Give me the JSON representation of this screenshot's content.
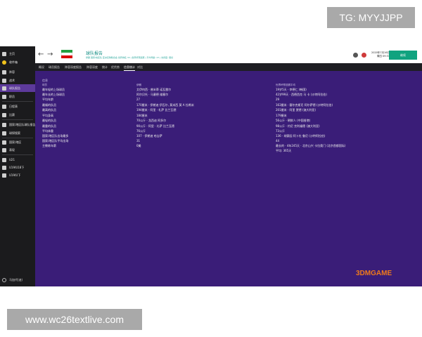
{
  "watermarks": {
    "tg": "TG: MYYJJPP",
    "url": "www.wc26textlive.com",
    "logo": "3DMGAME"
  },
  "sidebar": {
    "items": [
      {
        "label": "主页",
        "icon": "home-icon"
      },
      {
        "label": "收件箱",
        "icon": "coin-icon"
      },
      {
        "label": "阵容",
        "icon": "squad-icon"
      },
      {
        "label": "战术",
        "icon": "tactics-icon"
      },
      {
        "label": "球队报告",
        "icon": "report-icon"
      },
      {
        "label": "职员",
        "icon": "staff-icon"
      },
      {
        "label": "日程表",
        "icon": "calendar-icon"
      },
      {
        "label": "比赛",
        "icon": "trophy-icon"
      },
      {
        "label": "国家/地区队球队报告",
        "icon": "national-icon"
      },
      {
        "label": "球探搜索",
        "icon": "search-icon"
      },
      {
        "label": "国家/地区",
        "icon": "globe-icon"
      },
      {
        "label": "表现",
        "icon": "chart-icon"
      },
      {
        "label": "U21",
        "icon": "team-icon"
      },
      {
        "label": "U19/U18下",
        "icon": "team-icon"
      },
      {
        "label": "U19/U下",
        "icon": "team-icon"
      }
    ],
    "user": "马加代(迪)"
  },
  "header": {
    "title": "球队报告",
    "subtitle": "伊朗 国家/地区队 亚洲足球联合会 世界排名 33 | 世界杯预选赛 | 平均年龄: 27 | 支持度: 很好",
    "date": "2020年7月16日",
    "weekday": "周四 09:31",
    "continue": "继续"
  },
  "tabs": [
    {
      "label": "概况",
      "active": false
    },
    {
      "label": "球员报告",
      "active": false
    },
    {
      "label": "阵容深度报告",
      "active": false
    },
    {
      "label": "阵容深度",
      "active": false
    },
    {
      "label": "统计",
      "active": false
    },
    {
      "label": "优劣势",
      "active": false
    },
    {
      "label": "信息统计",
      "active": true
    },
    {
      "label": "对比",
      "active": false
    }
  ],
  "content": {
    "section_label": "信息",
    "col_headers": [
      "球员",
      "伊朗",
      "世界杯预选赛平均"
    ],
    "rows": [
      {
        "label": "最年轻的上场球员",
        "v1": "艾伊何西 · 普米蒂 诺瓦雷尔",
        "v2": "19岁5天 · 李德仁 (韩国)"
      },
      {
        "label": "最年长的上场球员",
        "v1": "阿尔贝托 · 马塞德 维塞尔",
        "v2": "42岁99天 · 西德西克 马 卡 (沙特阿拉伯)"
      },
      {
        "label": "平均年龄",
        "v1": "27",
        "v2": "29"
      },
      {
        "label": "最矮的队员",
        "v1": "170厘米 · 伊朗迪 伊瓦尔, 莫米西 莫 A 拉希米",
        "v2": "163厘米 · 塞尔克斯尼 阿尔萨德 (沙特阿拉伯)"
      },
      {
        "label": "最高的队员",
        "v1": "194厘米 · 阿里 · 礼萨 比兰瓦德",
        "v2": "201厘米 · 阿里 贾德 (澳大利亚)"
      },
      {
        "label": "平均身高",
        "v1": "184厘米",
        "v2": "179厘米"
      },
      {
        "label": "最轻的队员",
        "v1": "70公斤 · 龙西迪 阿多尔",
        "v2": "56公斤 · 朝鲜人 (中国香港)"
      },
      {
        "label": "最重的队员",
        "v1": "90公斤 · 阿里 · 礼萨 比兰瓦德",
        "v2": "98公斤 · 约尼 克利福德 (澳大利亚)"
      },
      {
        "label": "平均体重",
        "v1": "76公斤",
        "v2": "73公斤"
      },
      {
        "label": "国家/地区队出场最多",
        "v1": "107 · 伊朗迪 哈吉萨",
        "v2": "136 · 胡赛因 阿卜杜 鲁尼 (沙特阿拉伯)"
      },
      {
        "label": "国家/地区队平均出场",
        "v1": "31",
        "v2": "44"
      },
      {
        "label": "主教练年薪",
        "v1": "0美",
        "v2": "最长的 · 4年245天 · 北京山兴 卡拉奥门 (北京首都国际)"
      },
      {
        "label": "",
        "v1": "",
        "v2": "平均: 365天"
      }
    ]
  },
  "colors": {
    "app_background": "#3a1d78",
    "sidebar": "#1b1b1d",
    "accent_green": "#10a37f",
    "header_teal": "#0c8a80"
  }
}
